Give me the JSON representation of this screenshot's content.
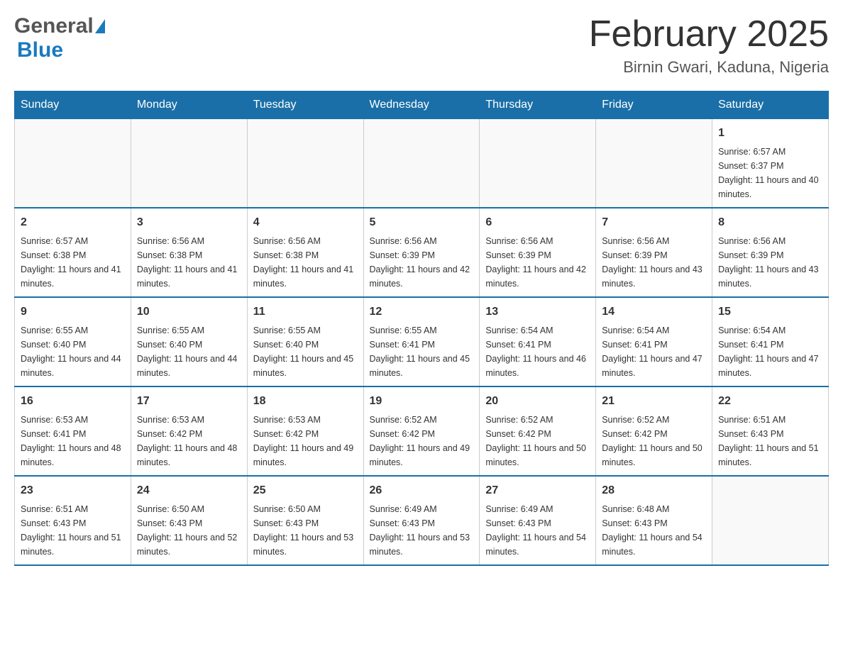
{
  "header": {
    "logo": {
      "general": "General",
      "blue": "Blue",
      "arrow_color": "#1a7abf"
    },
    "title": "February 2025",
    "location": "Birnin Gwari, Kaduna, Nigeria"
  },
  "calendar": {
    "days_of_week": [
      "Sunday",
      "Monday",
      "Tuesday",
      "Wednesday",
      "Thursday",
      "Friday",
      "Saturday"
    ],
    "weeks": [
      [
        {
          "day": "",
          "info": ""
        },
        {
          "day": "",
          "info": ""
        },
        {
          "day": "",
          "info": ""
        },
        {
          "day": "",
          "info": ""
        },
        {
          "day": "",
          "info": ""
        },
        {
          "day": "",
          "info": ""
        },
        {
          "day": "1",
          "info": "Sunrise: 6:57 AM\nSunset: 6:37 PM\nDaylight: 11 hours and 40 minutes."
        }
      ],
      [
        {
          "day": "2",
          "info": "Sunrise: 6:57 AM\nSunset: 6:38 PM\nDaylight: 11 hours and 41 minutes."
        },
        {
          "day": "3",
          "info": "Sunrise: 6:56 AM\nSunset: 6:38 PM\nDaylight: 11 hours and 41 minutes."
        },
        {
          "day": "4",
          "info": "Sunrise: 6:56 AM\nSunset: 6:38 PM\nDaylight: 11 hours and 41 minutes."
        },
        {
          "day": "5",
          "info": "Sunrise: 6:56 AM\nSunset: 6:39 PM\nDaylight: 11 hours and 42 minutes."
        },
        {
          "day": "6",
          "info": "Sunrise: 6:56 AM\nSunset: 6:39 PM\nDaylight: 11 hours and 42 minutes."
        },
        {
          "day": "7",
          "info": "Sunrise: 6:56 AM\nSunset: 6:39 PM\nDaylight: 11 hours and 43 minutes."
        },
        {
          "day": "8",
          "info": "Sunrise: 6:56 AM\nSunset: 6:39 PM\nDaylight: 11 hours and 43 minutes."
        }
      ],
      [
        {
          "day": "9",
          "info": "Sunrise: 6:55 AM\nSunset: 6:40 PM\nDaylight: 11 hours and 44 minutes."
        },
        {
          "day": "10",
          "info": "Sunrise: 6:55 AM\nSunset: 6:40 PM\nDaylight: 11 hours and 44 minutes."
        },
        {
          "day": "11",
          "info": "Sunrise: 6:55 AM\nSunset: 6:40 PM\nDaylight: 11 hours and 45 minutes."
        },
        {
          "day": "12",
          "info": "Sunrise: 6:55 AM\nSunset: 6:41 PM\nDaylight: 11 hours and 45 minutes."
        },
        {
          "day": "13",
          "info": "Sunrise: 6:54 AM\nSunset: 6:41 PM\nDaylight: 11 hours and 46 minutes."
        },
        {
          "day": "14",
          "info": "Sunrise: 6:54 AM\nSunset: 6:41 PM\nDaylight: 11 hours and 47 minutes."
        },
        {
          "day": "15",
          "info": "Sunrise: 6:54 AM\nSunset: 6:41 PM\nDaylight: 11 hours and 47 minutes."
        }
      ],
      [
        {
          "day": "16",
          "info": "Sunrise: 6:53 AM\nSunset: 6:41 PM\nDaylight: 11 hours and 48 minutes."
        },
        {
          "day": "17",
          "info": "Sunrise: 6:53 AM\nSunset: 6:42 PM\nDaylight: 11 hours and 48 minutes."
        },
        {
          "day": "18",
          "info": "Sunrise: 6:53 AM\nSunset: 6:42 PM\nDaylight: 11 hours and 49 minutes."
        },
        {
          "day": "19",
          "info": "Sunrise: 6:52 AM\nSunset: 6:42 PM\nDaylight: 11 hours and 49 minutes."
        },
        {
          "day": "20",
          "info": "Sunrise: 6:52 AM\nSunset: 6:42 PM\nDaylight: 11 hours and 50 minutes."
        },
        {
          "day": "21",
          "info": "Sunrise: 6:52 AM\nSunset: 6:42 PM\nDaylight: 11 hours and 50 minutes."
        },
        {
          "day": "22",
          "info": "Sunrise: 6:51 AM\nSunset: 6:43 PM\nDaylight: 11 hours and 51 minutes."
        }
      ],
      [
        {
          "day": "23",
          "info": "Sunrise: 6:51 AM\nSunset: 6:43 PM\nDaylight: 11 hours and 51 minutes."
        },
        {
          "day": "24",
          "info": "Sunrise: 6:50 AM\nSunset: 6:43 PM\nDaylight: 11 hours and 52 minutes."
        },
        {
          "day": "25",
          "info": "Sunrise: 6:50 AM\nSunset: 6:43 PM\nDaylight: 11 hours and 53 minutes."
        },
        {
          "day": "26",
          "info": "Sunrise: 6:49 AM\nSunset: 6:43 PM\nDaylight: 11 hours and 53 minutes."
        },
        {
          "day": "27",
          "info": "Sunrise: 6:49 AM\nSunset: 6:43 PM\nDaylight: 11 hours and 54 minutes."
        },
        {
          "day": "28",
          "info": "Sunrise: 6:48 AM\nSunset: 6:43 PM\nDaylight: 11 hours and 54 minutes."
        },
        {
          "day": "",
          "info": ""
        }
      ]
    ]
  }
}
